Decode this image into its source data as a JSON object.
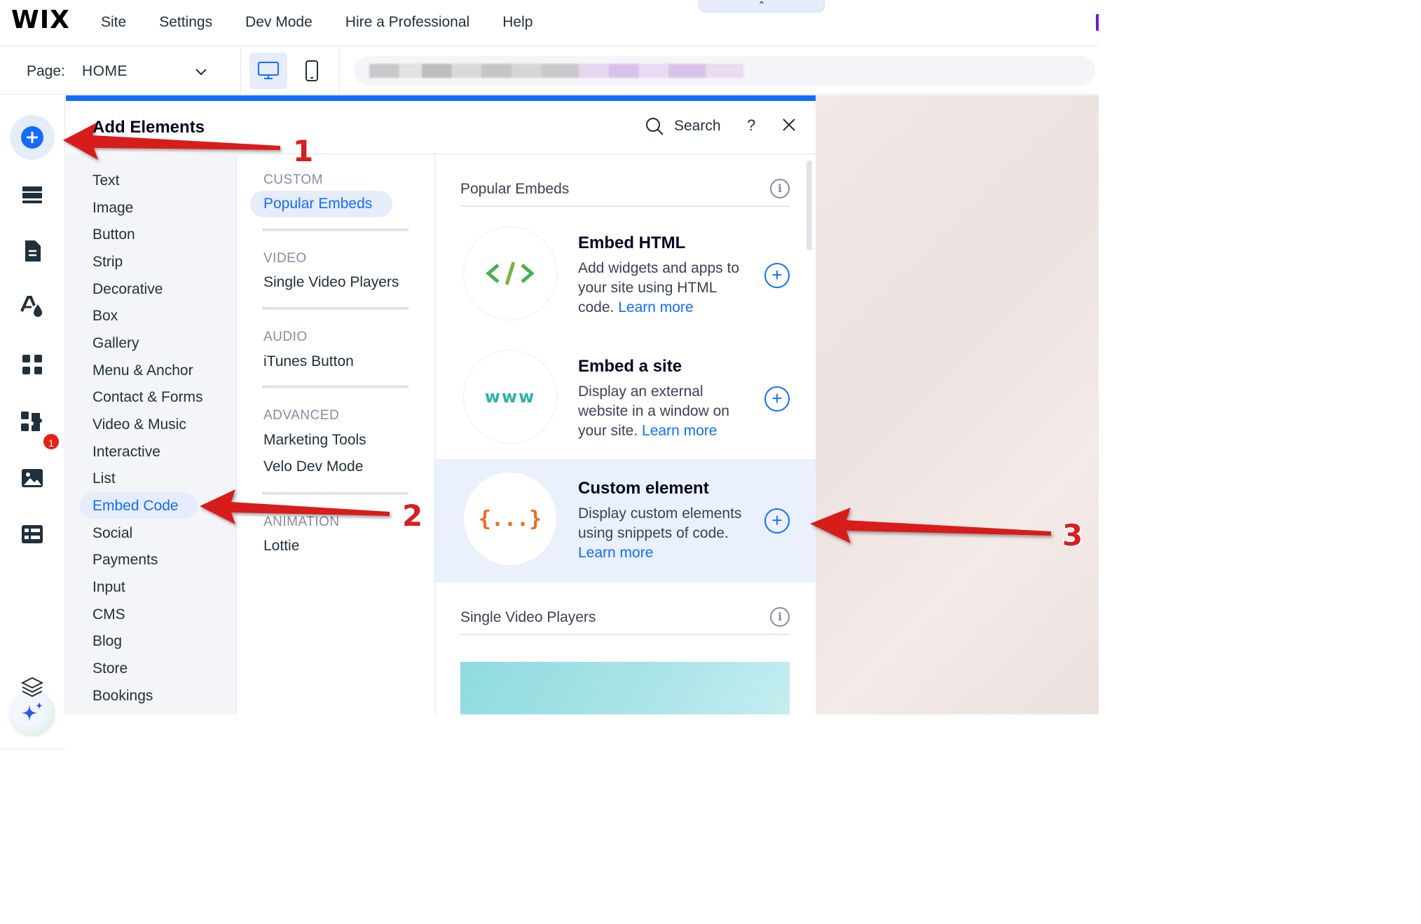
{
  "topbar": {
    "logo": "WIX",
    "menu": [
      "Site",
      "Settings",
      "Dev Mode",
      "Hire a Professional",
      "Help"
    ],
    "collapse_glyph": "⌃"
  },
  "pagebar": {
    "page_label": "Page:",
    "page_value": "HOME"
  },
  "rail": {
    "apps_badge": "1",
    "icons": [
      "add-elements-icon",
      "sections-icon",
      "pages-icon",
      "design-icon",
      "apps-icon",
      "business-apps-icon",
      "media-icon",
      "cms-icon",
      "ai-assistant-icon",
      "layers-icon"
    ]
  },
  "panel": {
    "title": "Add Elements",
    "search_label": "Search",
    "help": "?",
    "categories": [
      "Text",
      "Image",
      "Button",
      "Strip",
      "Decorative",
      "Box",
      "Gallery",
      "Menu & Anchor",
      "Contact & Forms",
      "Video & Music",
      "Interactive",
      "List",
      "Embed Code",
      "Social",
      "Payments",
      "Input",
      "CMS",
      "Blog",
      "Store",
      "Bookings"
    ],
    "selected_category": "Embed Code",
    "subsections": [
      {
        "heading": "CUSTOM",
        "items": [
          "Popular Embeds"
        ]
      },
      {
        "heading": "VIDEO",
        "items": [
          "Single Video Players"
        ]
      },
      {
        "heading": "AUDIO",
        "items": [
          "iTunes Button"
        ]
      },
      {
        "heading": "ADVANCED",
        "items": [
          "Marketing Tools",
          "Velo Dev Mode"
        ]
      },
      {
        "heading": "ANIMATION",
        "items": [
          "Lottie"
        ]
      }
    ],
    "content": {
      "section1_title": "Popular Embeds",
      "cards": [
        {
          "icon_text": "</>",
          "title": "Embed HTML",
          "desc": "Add widgets and apps to your site using HTML code.",
          "learn": "Learn more"
        },
        {
          "icon_text": "www",
          "title": "Embed a site",
          "desc": "Display an external website in a window on your site.",
          "learn": "Learn more"
        },
        {
          "icon_text": "{...}",
          "title": "Custom element",
          "desc": "Display custom elements using snippets of code.",
          "learn": "Learn more"
        }
      ],
      "section2_title": "Single Video Players",
      "info_glyph": "i",
      "plus_glyph": "+"
    }
  },
  "annotations": [
    "1",
    "2",
    "3"
  ],
  "colors": {
    "accent": "#116dff",
    "arrow": "#d71f1f",
    "highlight": "#e7ecfa",
    "html_icon": "#4caf50",
    "www_icon": "#2bb3a8",
    "custom_icon": "#f06b1b"
  }
}
